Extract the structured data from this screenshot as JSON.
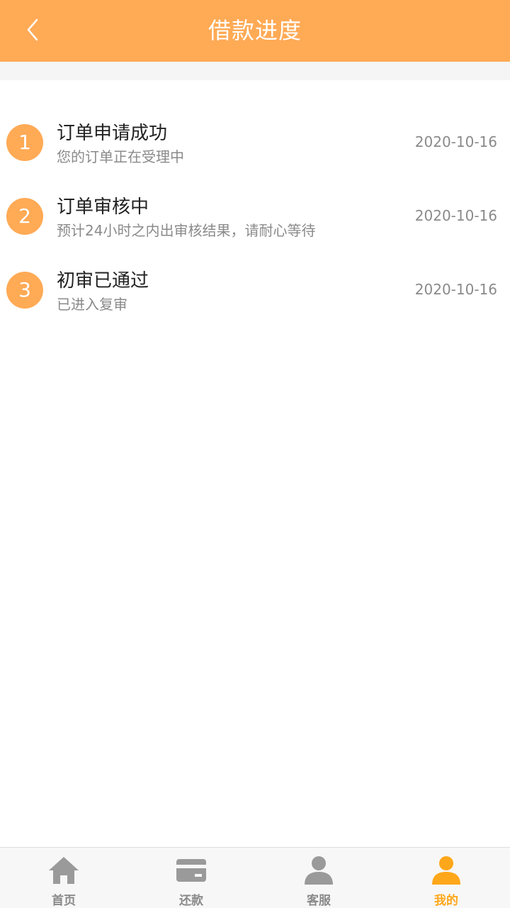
{
  "header": {
    "title": "借款进度",
    "back_icon": "chevron-left-icon"
  },
  "steps": [
    {
      "number": "1",
      "title": "订单申请成功",
      "subtitle": "您的订单正在受理中",
      "date": "2020-10-16"
    },
    {
      "number": "2",
      "title": "订单审核中",
      "subtitle": "预计24小时之内出审核结果，请耐心等待",
      "date": "2020-10-16"
    },
    {
      "number": "3",
      "title": "初审已通过",
      "subtitle": "已进入复审",
      "date": "2020-10-16"
    }
  ],
  "tabbar": {
    "items": [
      {
        "label": "首页",
        "icon": "home-icon",
        "active": false
      },
      {
        "label": "还款",
        "icon": "card-icon",
        "active": false
      },
      {
        "label": "客服",
        "icon": "person-icon",
        "active": false
      },
      {
        "label": "我的",
        "icon": "person-icon",
        "active": true
      }
    ]
  },
  "colors": {
    "accent": "#FFAA55",
    "active_tab": "#FFA71A",
    "inactive_tab": "#8A8A8A"
  }
}
